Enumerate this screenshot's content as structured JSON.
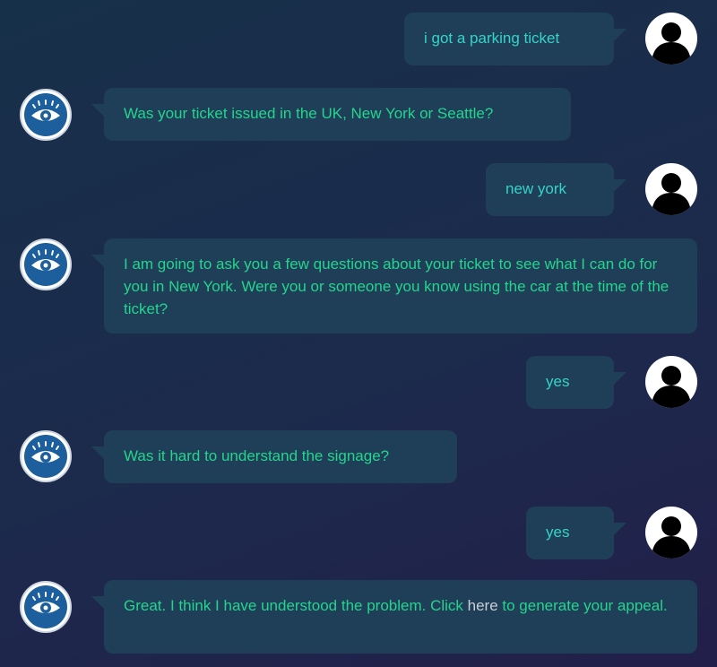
{
  "messages": [
    {
      "from": "user",
      "text": "i got a parking ticket"
    },
    {
      "from": "bot",
      "text": "Was your ticket issued in the UK, New York or Seattle?"
    },
    {
      "from": "user",
      "text": "new york"
    },
    {
      "from": "bot",
      "text": "I am going to ask you a few questions about your ticket to see what I can do for you in New York. Were you or someone you know using the car at the time of the ticket?"
    },
    {
      "from": "user",
      "text": "yes"
    },
    {
      "from": "bot",
      "text": "Was it hard to understand the signage?"
    },
    {
      "from": "user",
      "text": "yes"
    },
    {
      "from": "bot",
      "text_before": "Great. I think I have understood the problem. Click ",
      "link_text": "here",
      "text_after": " to generate your appeal."
    }
  ],
  "icons": {
    "user_avatar": "user-silhouette-icon",
    "bot_avatar": "eye-icon"
  },
  "colors": {
    "bubble_bg": "#1f3f58",
    "user_text": "#35d3c8",
    "bot_text": "#25d48d",
    "link": "#c8cdd6"
  }
}
